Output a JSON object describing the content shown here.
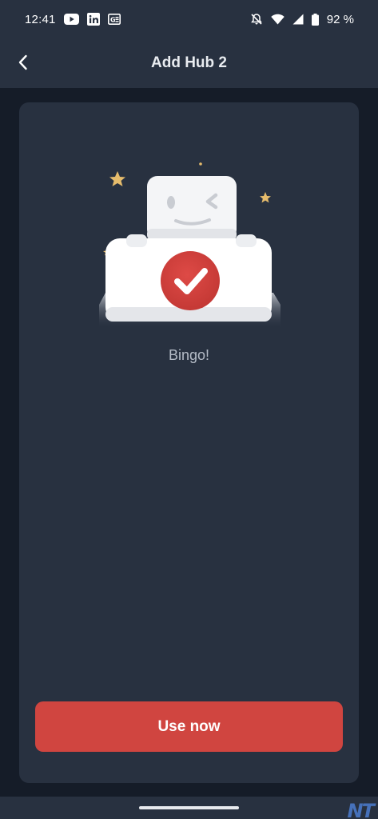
{
  "status_bar": {
    "time": "12:41",
    "battery": "92 %",
    "icons": [
      "youtube-icon",
      "linkedin-icon",
      "news-icon",
      "notifications-off-icon",
      "wifi-icon",
      "signal-icon",
      "battery-icon"
    ]
  },
  "app_bar": {
    "title": "Add Hub 2",
    "back_icon": "chevron-left-icon"
  },
  "content": {
    "illustration": "hub-device-checkmark-illustration",
    "message": "Bingo!",
    "primary_button": "Use now"
  },
  "colors": {
    "background": "#151c28",
    "surface": "#283140",
    "accent": "#d04540",
    "text_muted": "#b5bcc7"
  },
  "watermark": "NT"
}
